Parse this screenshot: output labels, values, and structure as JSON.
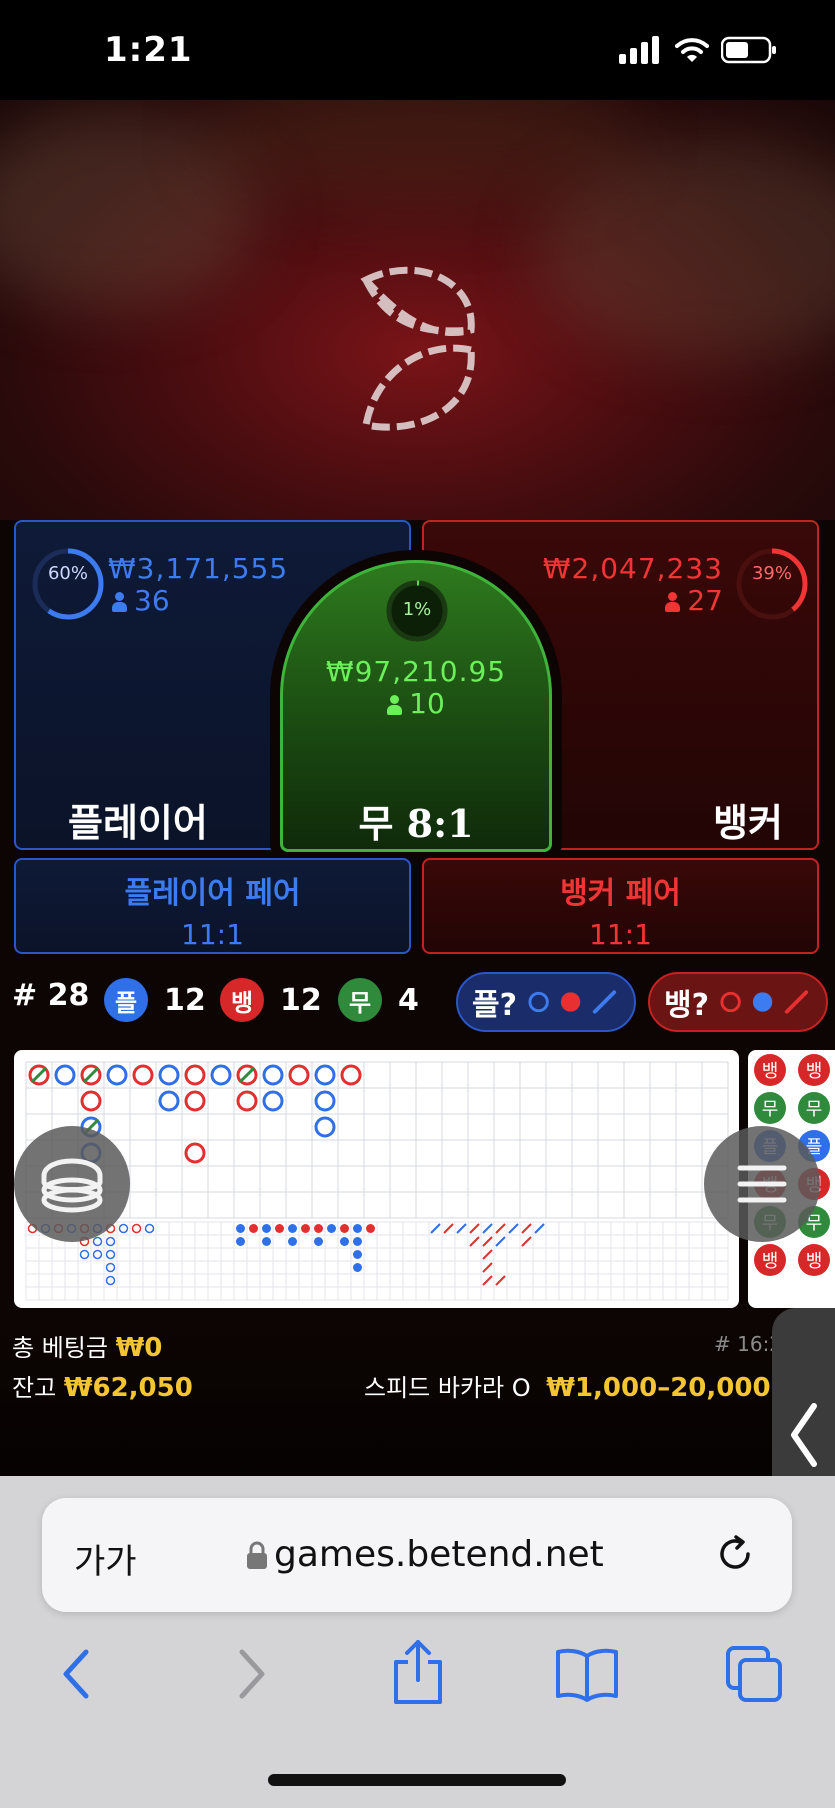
{
  "status_bar": {
    "time": "1:21"
  },
  "player": {
    "percent": "60%",
    "amount": "₩3,171,555",
    "players": "36",
    "label": "플레이어",
    "color": "#3d7bf0"
  },
  "tie": {
    "percent": "1%",
    "amount": "₩97,210.95",
    "players": "10",
    "label": "무 8:1",
    "color": "#5ce04a"
  },
  "banker": {
    "percent": "39%",
    "amount": "₩2,047,233",
    "players": "27",
    "label": "뱅커",
    "color": "#f03535"
  },
  "player_pair": {
    "title": "플레이어 페어",
    "odds": "11:1"
  },
  "banker_pair": {
    "title": "뱅커 페어",
    "odds": "11:1"
  },
  "stats": {
    "round": "# 28",
    "player_chip": "플",
    "player_count": "12",
    "banker_chip": "뱅",
    "banker_count": "12",
    "tie_chip": "무",
    "tie_count": "4",
    "player_predict": "플?",
    "banker_predict": "뱅?"
  },
  "side_road": [
    "뱅",
    "무",
    "플",
    "뱅",
    "무",
    "뱅"
  ],
  "info": {
    "total_bet_label": "총 베팅금",
    "total_bet_value": "₩0",
    "balance_label": "잔고",
    "balance_value": "₩62,050",
    "game_id": "# 16:2",
    "table_name": "스피드 바카라 O",
    "limits": "₩1,000–20,000,("
  },
  "browser": {
    "text_size": "가가",
    "url": "games.betend.net"
  },
  "icons": [
    "signal-icon",
    "wifi-icon",
    "battery-icon",
    "logo-icon",
    "person-icon",
    "lock-icon",
    "reload-icon",
    "back-icon",
    "forward-icon",
    "share-icon",
    "bookmarks-icon",
    "tabs-icon",
    "chevron-left-icon"
  ]
}
